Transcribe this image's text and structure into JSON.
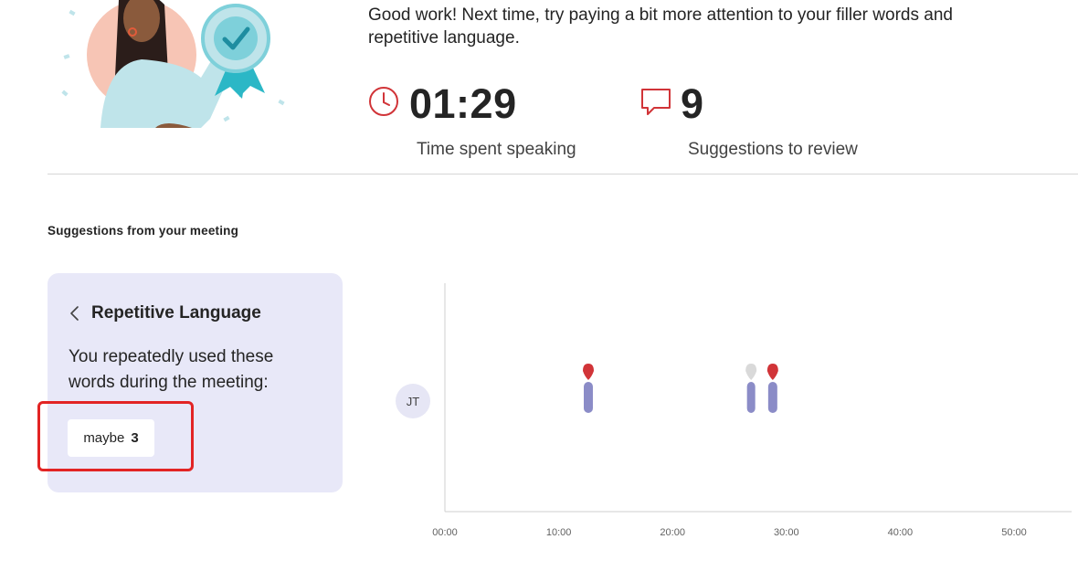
{
  "feedback": {
    "message": "Good work! Next time, try paying a bit more attention to your filler words and repetitive language."
  },
  "stats": {
    "time": {
      "value": "01:29",
      "label": "Time spent speaking",
      "icon": "clock-icon"
    },
    "suggestions": {
      "value": "9",
      "label": "Suggestions to review",
      "icon": "speech-bubble-icon"
    }
  },
  "section": {
    "title": "Suggestions from your meeting"
  },
  "panel": {
    "title": "Repetitive Language",
    "description": "You repeatedly used these words during the meeting:",
    "words": [
      {
        "word": "maybe",
        "count": "3"
      }
    ]
  },
  "timeline": {
    "participant": "JT",
    "ticks": [
      "00:00",
      "10:00",
      "20:00",
      "30:00",
      "40:00",
      "50:00"
    ],
    "axis_minutes": [
      0,
      50
    ],
    "segments_minutes": [
      {
        "start": 12.2,
        "end": 13.0,
        "marker": "red"
      },
      {
        "start": 26.6,
        "end": 27.2,
        "marker": "gray"
      },
      {
        "start": 28.4,
        "end": 29.2,
        "marker": "red"
      }
    ]
  },
  "colors": {
    "accent_red": "#d13438",
    "segment": "#8b8cc7",
    "panel_bg": "#e8e8f8",
    "marker_gray": "#d9d9d9"
  }
}
